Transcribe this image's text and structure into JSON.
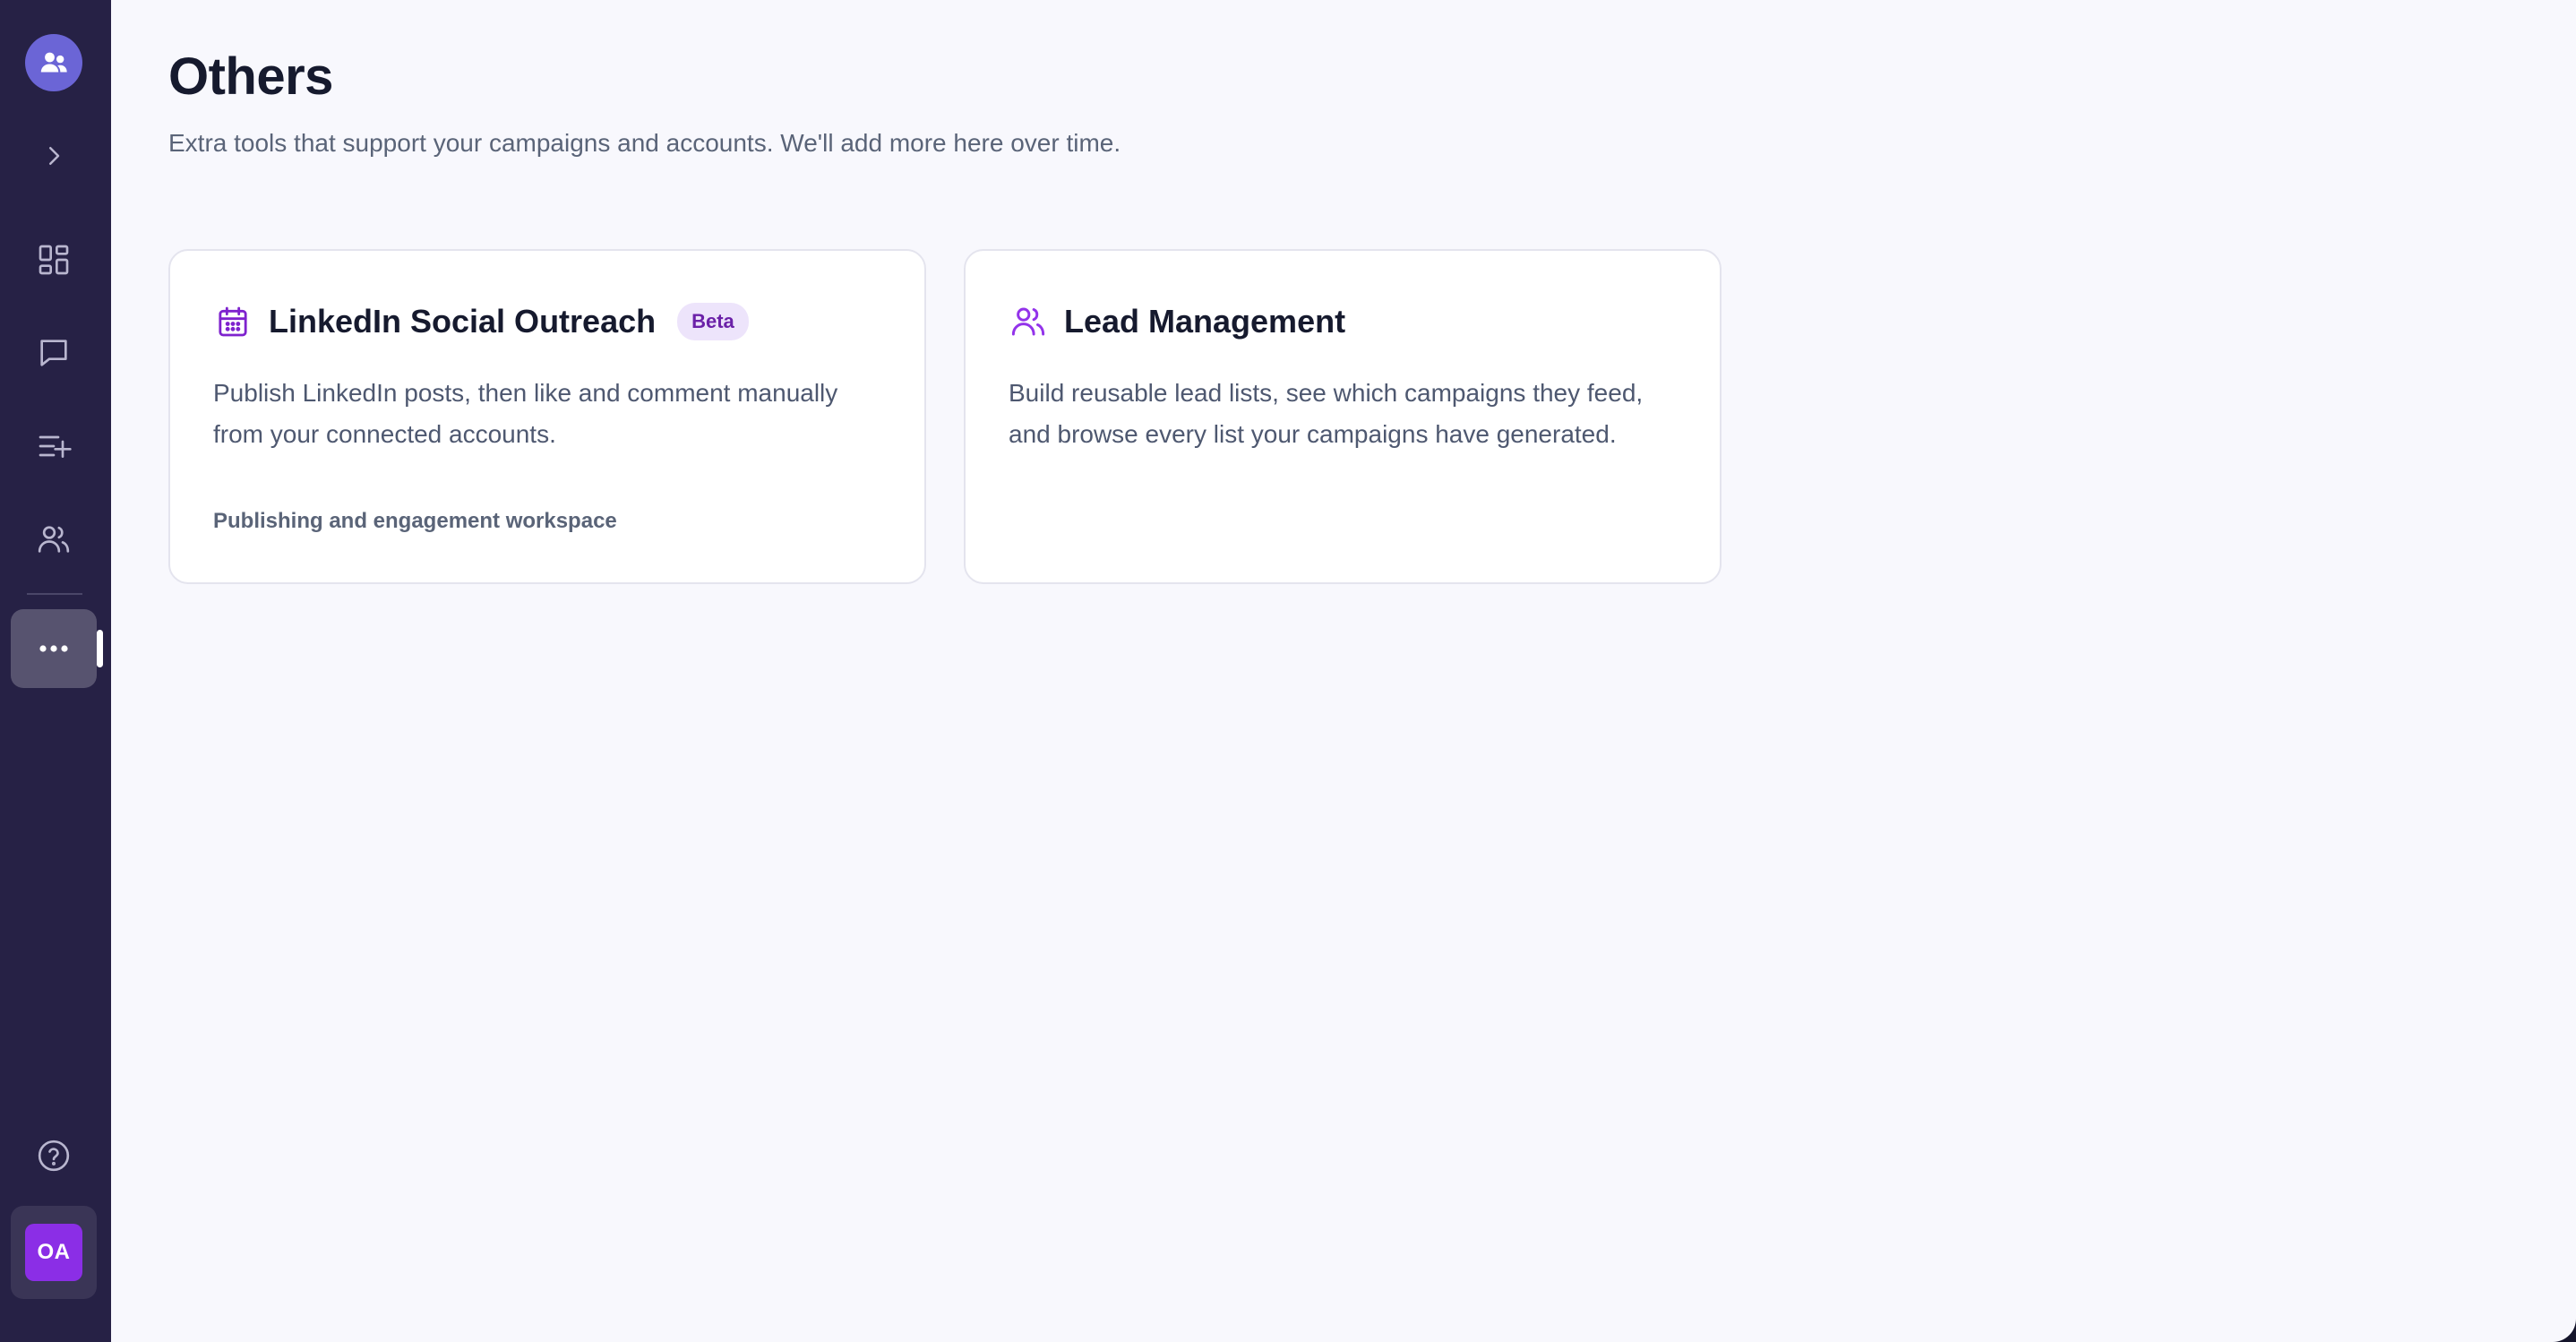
{
  "sidebar": {
    "logo_icon": "users-icon",
    "items": [
      {
        "name": "expand",
        "icon": "chevron-right-icon"
      },
      {
        "name": "dashboard",
        "icon": "dashboard-grid-icon"
      },
      {
        "name": "messages",
        "icon": "chat-bubble-icon"
      },
      {
        "name": "campaigns",
        "icon": "list-plus-icon"
      },
      {
        "name": "leads",
        "icon": "users-outline-icon"
      },
      {
        "name": "others",
        "icon": "more-horizontal-icon",
        "active": true
      }
    ],
    "help_icon": "help-circle-icon",
    "avatar_initials": "OA",
    "accent_color": "#8b2ee6",
    "background_color": "#262145"
  },
  "main": {
    "title": "Others",
    "subtitle": "Extra tools that support your campaigns and accounts. We'll add more here over time.",
    "cards": [
      {
        "icon": "calendar-icon",
        "title": "LinkedIn Social Outreach",
        "badge": "Beta",
        "description": "Publish LinkedIn posts, then like and comment manually from your connected accounts.",
        "footer": "Publishing and engagement workspace"
      },
      {
        "icon": "users-outline-icon",
        "title": "Lead Management",
        "description": "Build reusable lead lists, see which campaigns they feed, and browse every list your campaigns have generated."
      }
    ]
  }
}
